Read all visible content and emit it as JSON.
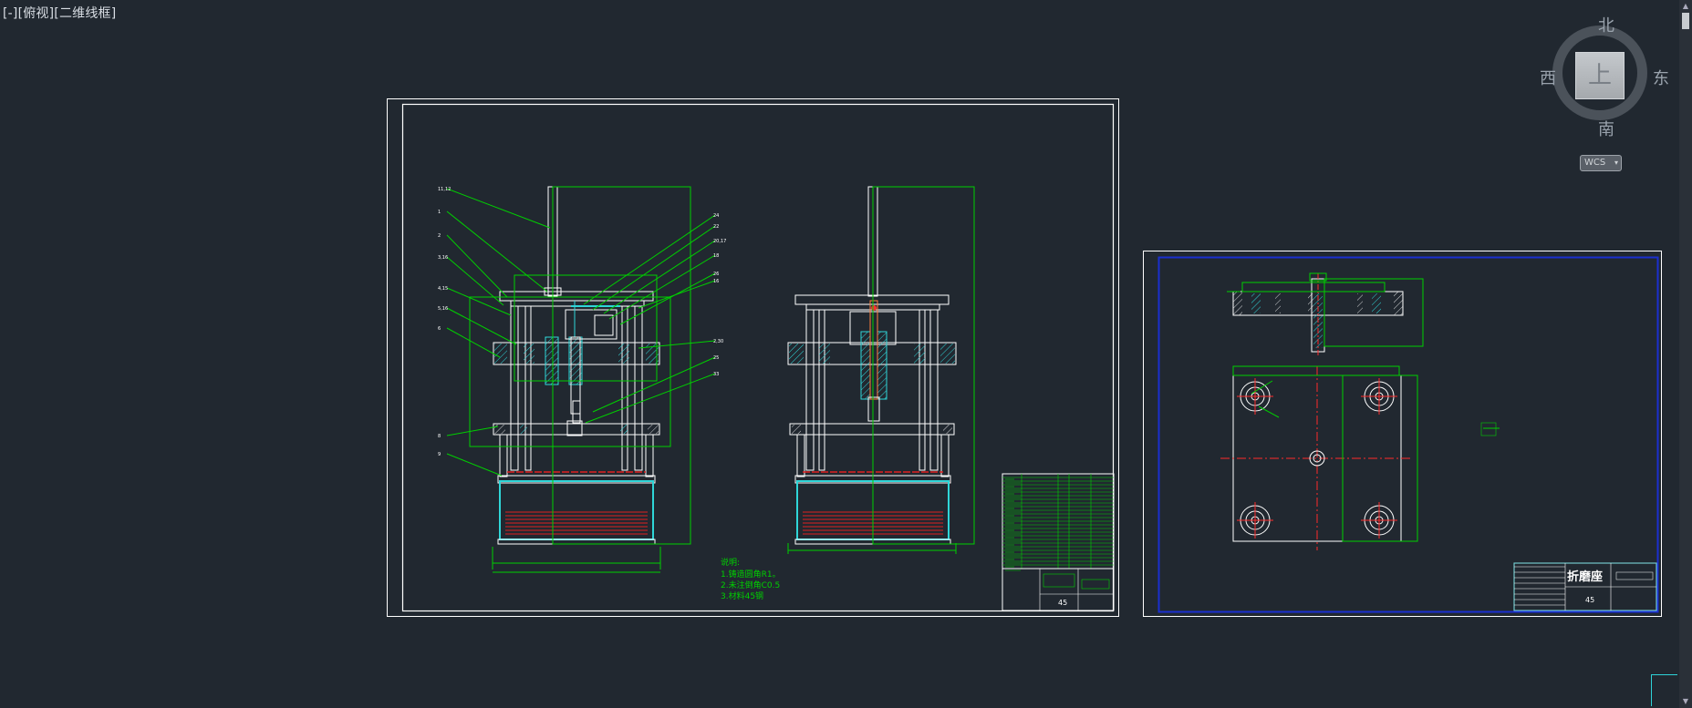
{
  "viewport": {
    "label": "[-][俯视][二维线框]"
  },
  "viewcube": {
    "north": "北",
    "south": "南",
    "west": "西",
    "east": "东",
    "face": "上",
    "wcs": "WCS",
    "wcs_arrow": "▾"
  },
  "scrollbar": {
    "up": "▲",
    "down": "▼"
  },
  "sheet1": {
    "notes_title": "说明:",
    "notes": [
      "1.铸造圆角R1。",
      "2.未注倒角C0.5",
      "3.材料45钢"
    ],
    "title_block_value": "45",
    "leader_labels_left": [
      "11,12",
      "1",
      "2",
      "3,16",
      "4,15",
      "5,16",
      "6",
      "8",
      "9"
    ],
    "leader_labels_right": [
      "24",
      "22",
      "20,17",
      "18",
      "26",
      "16",
      "2,30",
      "25",
      "33"
    ]
  },
  "sheet2": {
    "title": "折磨座",
    "title_block_value": "45"
  },
  "colors": {
    "background": "#212830",
    "frame": "#ffffff",
    "dimension": "#00d000",
    "geometry": "#ffffff",
    "section": "#2fd6d8",
    "hatch": "#e02020",
    "border_blue": "#1a2fd0",
    "center": "#ff2a2a",
    "cursor_red": "#ff3030"
  },
  "icons": [
    "viewcube-icon",
    "wcs-dropdown-icon",
    "scroll-up-icon",
    "scroll-down-icon",
    "ucs-icon"
  ]
}
